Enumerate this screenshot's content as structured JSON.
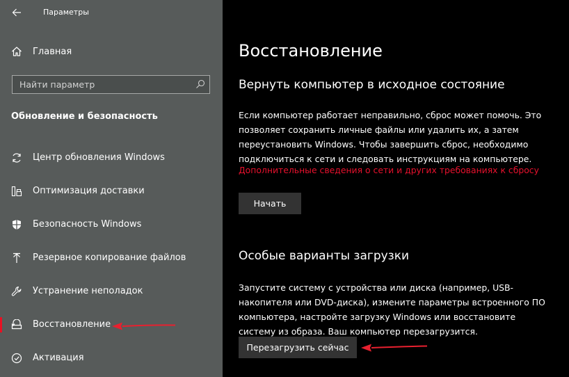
{
  "window": {
    "title": "Параметры"
  },
  "sidebar": {
    "home_label": "Главная",
    "search": {
      "placeholder": "Найти параметр",
      "value": ""
    },
    "section_title": "Обновление и безопасность",
    "items": [
      {
        "label": "Центр обновления Windows",
        "icon": "sync-icon"
      },
      {
        "label": "Оптимизация доставки",
        "icon": "delivery-icon"
      },
      {
        "label": "Безопасность Windows",
        "icon": "shield-icon"
      },
      {
        "label": "Резервное копирование файлов",
        "icon": "backup-icon"
      },
      {
        "label": "Устранение неполадок",
        "icon": "wrench-icon"
      },
      {
        "label": "Восстановление",
        "icon": "recovery-icon",
        "active": true
      },
      {
        "label": "Активация",
        "icon": "activation-icon"
      }
    ]
  },
  "main": {
    "title": "Восстановление",
    "reset": {
      "heading": "Вернуть компьютер в исходное состояние",
      "description": "Если компьютер работает неправильно, сброс может помочь. Это позволяет сохранить личные файлы или удалить их, а затем переустановить Windows. Чтобы завершить сброс, необходимо подключиться к сети и следовать инструкциям на компьютере.",
      "link": "Дополнительные сведения о сети и других требованиях к сбросу",
      "button": "Начать"
    },
    "advanced": {
      "heading": "Особые варианты загрузки",
      "description": "Запустите систему с устройства или диска (например, USB-накопителя или DVD-диска), измените параметры встроенного ПО компьютера, настройте загрузку Windows или восстановите систему из образа. Ваш компьютер перезагрузится.",
      "button": "Перезагрузить сейчас"
    }
  },
  "colors": {
    "sidebar_bg": "#575b5a",
    "main_bg": "#000000",
    "accent": "#e81123",
    "link": "#e8112d",
    "button_bg": "#333333",
    "annotation_arrow": "#e8202f"
  }
}
